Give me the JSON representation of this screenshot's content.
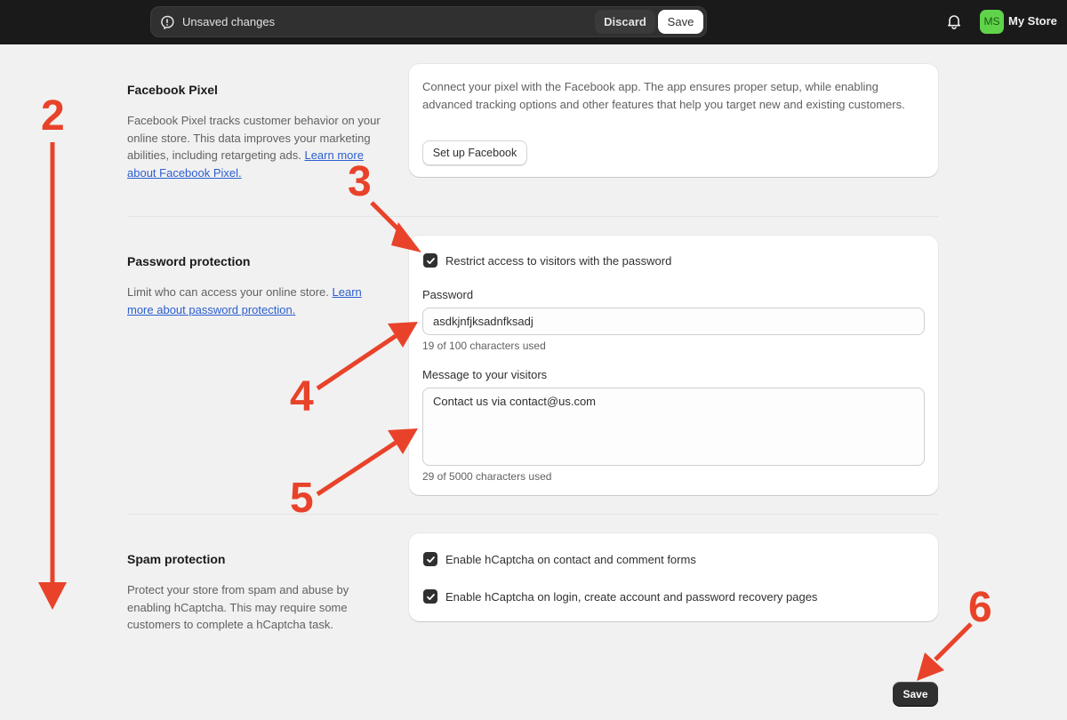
{
  "topbar": {
    "unsaved_label": "Unsaved changes",
    "discard_label": "Discard",
    "save_label": "Save",
    "notifications_icon": "bell-icon",
    "avatar_initials": "MS",
    "avatar_color": "#5fd44a",
    "store_name": "My Store"
  },
  "sections": {
    "facebook_pixel": {
      "title": "Facebook Pixel",
      "description": "Facebook Pixel tracks customer behavior on your online store. This data improves your marketing abilities, including retargeting ads.",
      "link_text": "Learn more about Facebook Pixel.",
      "card_text": "Connect your pixel with the Facebook app. The app ensures proper setup, while enabling advanced tracking options and other features that help you target new and existing customers.",
      "button_label": "Set up Facebook"
    },
    "password_protection": {
      "title": "Password protection",
      "description": "Limit who can access your online store.",
      "link_text": "Learn more about password protection.",
      "restrict_checkbox_label": "Restrict access to visitors with the password",
      "restrict_checked": true,
      "password_label": "Password",
      "password_value": "asdkjnfjksadnfksadj",
      "password_help": "19 of 100 characters used",
      "message_label": "Message to your visitors",
      "message_value": "Contact us via contact@us.com",
      "message_help": "29 of 5000 characters used"
    },
    "spam_protection": {
      "title": "Spam protection",
      "description": "Protect your store from spam and abuse by enabling hCaptcha. This may require some customers to complete a hCaptcha task.",
      "options": [
        {
          "label": "Enable hCaptcha on contact and comment forms",
          "checked": true
        },
        {
          "label": "Enable hCaptcha on login, create account and password recovery pages",
          "checked": true
        }
      ]
    }
  },
  "footer": {
    "save_label": "Save"
  },
  "annotations": {
    "color": "#e8432a",
    "labels": [
      "2",
      "3",
      "4",
      "5",
      "6"
    ]
  }
}
